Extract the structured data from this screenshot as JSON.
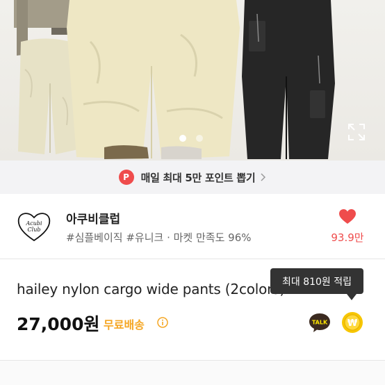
{
  "gallery": {
    "total_images": 2,
    "active_index": 0
  },
  "banner": {
    "badge": "P",
    "text": "매일 최대 5만 포인트 뽑기"
  },
  "shop": {
    "logo_text_1": "Acubi",
    "logo_text_2": "Club",
    "name": "아쿠비클럽",
    "tags": "#심플베이직 #유니크 · 마켓 만족도 96%",
    "like_count": "93.9만"
  },
  "product": {
    "title": "hailey nylon cargo wide pants (2colors)",
    "price": "27,000원",
    "shipping": "무료배송"
  },
  "tooltip": {
    "text": "최대 810원 적립"
  },
  "actions": {
    "talk_label": "TALK",
    "won_symbol": "₩"
  },
  "colors": {
    "accent_red": "#ef4c4c",
    "shipping_orange": "#f5a623",
    "talk_yellow": "#fee500",
    "pay_yellow": "#f7c600"
  }
}
